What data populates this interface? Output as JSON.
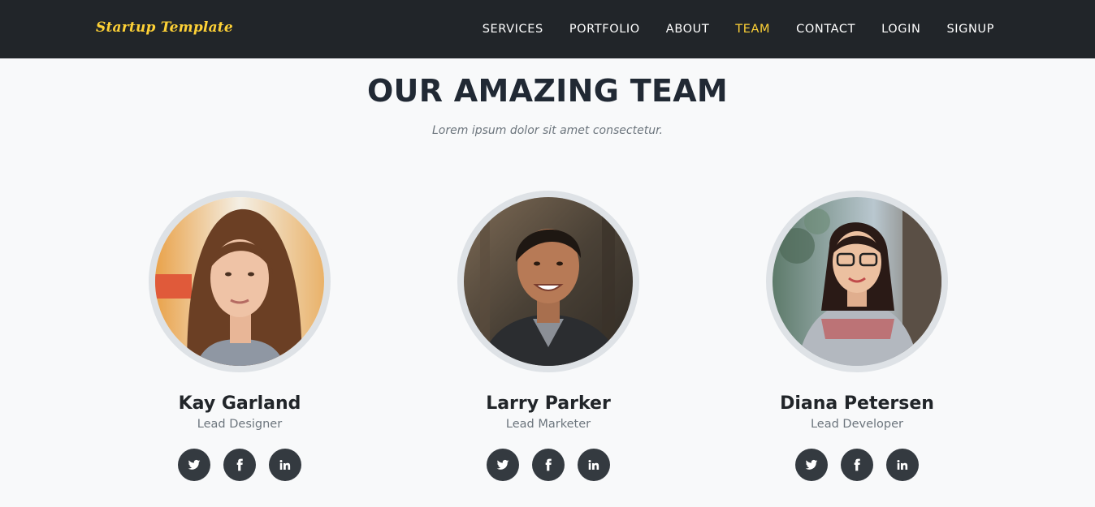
{
  "brand": "Startup Template",
  "nav": {
    "items": [
      {
        "label": "SERVICES"
      },
      {
        "label": "PORTFOLIO"
      },
      {
        "label": "ABOUT"
      },
      {
        "label": "TEAM",
        "active": true
      },
      {
        "label": "CONTACT"
      },
      {
        "label": "LOGIN"
      },
      {
        "label": "SIGNUP"
      }
    ]
  },
  "section": {
    "heading": "OUR AMAZING TEAM",
    "subheading": "Lorem ipsum dolor sit amet consectetur."
  },
  "team": [
    {
      "name": "Kay Garland",
      "role": "Lead Designer",
      "social": [
        "twitter-icon",
        "facebook-icon",
        "linkedin-icon"
      ]
    },
    {
      "name": "Larry Parker",
      "role": "Lead Marketer",
      "social": [
        "twitter-icon",
        "facebook-icon",
        "linkedin-icon"
      ]
    },
    {
      "name": "Diana Petersen",
      "role": "Lead Developer",
      "social": [
        "twitter-icon",
        "facebook-icon",
        "linkedin-icon"
      ]
    }
  ],
  "colors": {
    "navbar": "#212529",
    "accent": "#fed136",
    "background": "#f8f9fa",
    "social_button": "#343a40"
  }
}
